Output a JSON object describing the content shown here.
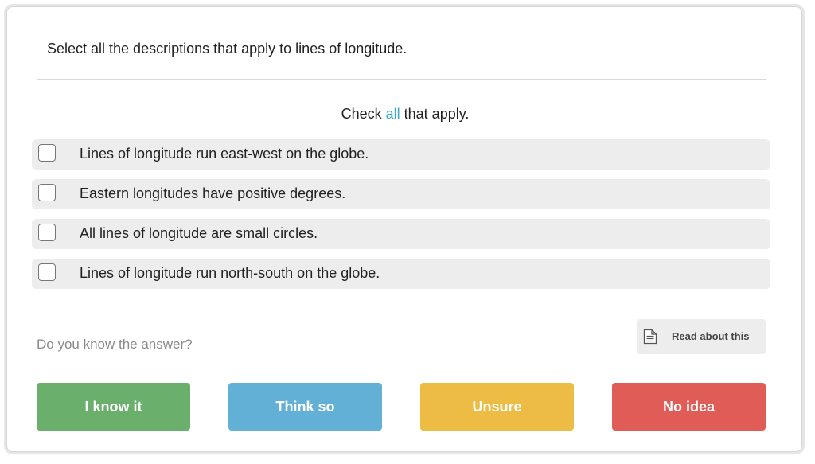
{
  "question": {
    "text": "Select all the descriptions that apply to lines of longitude."
  },
  "instruction": {
    "before": "Check ",
    "accent": "all",
    "after": " that apply.",
    "accent_color": "#3aa8c9"
  },
  "options": [
    {
      "label": "Lines of longitude run east-west on the globe.",
      "checked": false
    },
    {
      "label": "Eastern longitudes have positive degrees.",
      "checked": false
    },
    {
      "label": "All lines of longitude are small circles.",
      "checked": false
    },
    {
      "label": "Lines of longitude run north-south on the globe.",
      "checked": false
    }
  ],
  "confidence": {
    "prompt": "Do you know the answer?",
    "read_about": {
      "label": "Read about this",
      "icon": "document-icon"
    },
    "buttons": [
      {
        "label": "I know it",
        "color": "#6ab06c"
      },
      {
        "label": "Think so",
        "color": "#62b0d5"
      },
      {
        "label": "Unsure",
        "color": "#ecbc44"
      },
      {
        "label": "No idea",
        "color": "#e05c57"
      }
    ]
  }
}
